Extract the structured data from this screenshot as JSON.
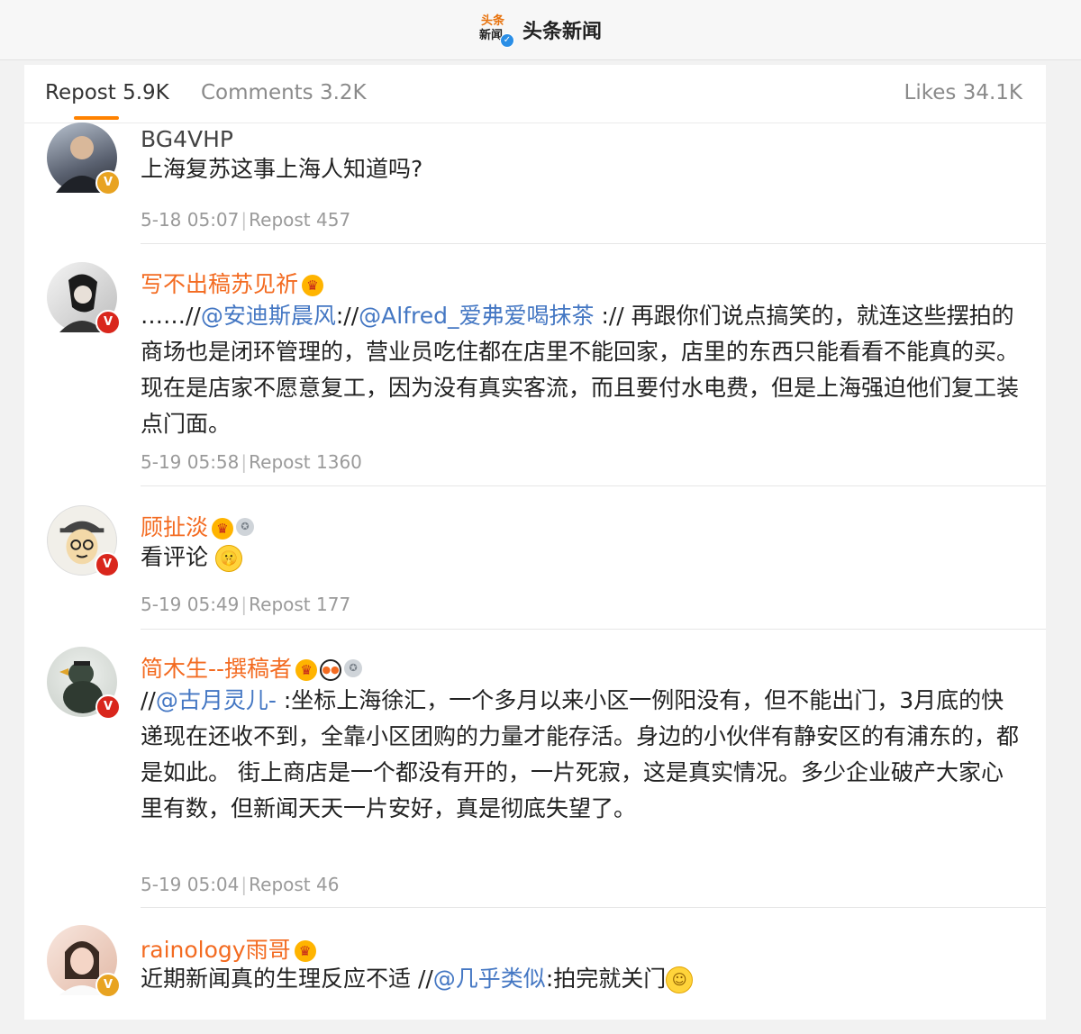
{
  "header": {
    "logo_line1": "头条",
    "logo_line2": "新闻",
    "title": "头条新闻"
  },
  "tabs": {
    "repost": "Repost 5.9K",
    "comments": "Comments 3.2K",
    "likes": "Likes 34.1K"
  },
  "colors": {
    "accent": "#ff8200",
    "username": "#f36b21",
    "mention": "#4477c3",
    "verified": "#e8a321",
    "verified_red": "#d9261c"
  },
  "posts": [
    {
      "username": "BG4VHP",
      "text": "上海复苏这事上海人知道吗?",
      "time": "5-18 05:07",
      "repost": "Repost 457"
    },
    {
      "username": "写不出稿苏见祈",
      "text_prefix": "……//",
      "mention1": "@安迪斯晨风",
      "text_mid": "://",
      "mention2": "@Alfred_爱弗爱喝抹茶",
      "text_body": " :// 再跟你们说点搞笑的，就连这些摆拍的商场也是闭环管理的，营业员吃住都在店里不能回家，店里的东西只能看看不能真的买。现在是店家不愿意复工，因为没有真实客流，而且要付水电费，但是上海强迫他们复工装点门面。",
      "time": "5-19 05:58",
      "repost": "Repost 1360"
    },
    {
      "username": "顾扯淡",
      "text": "看评论",
      "time": "5-19 05:49",
      "repost": "Repost 177"
    },
    {
      "username": "简木生--撰稿者",
      "text_prefix": "//",
      "mention": "@古月灵儿-",
      "text_body": " :坐标上海徐汇，一个多月以来小区一例阳没有，但不能出门，3月底的快递现在还收不到，全靠小区团购的力量才能存活。身边的小伙伴有静安区的有浦东的，都是如此。 街上商店是一个都没有开的，一片死寂，这是真实情况。多少企业破产大家心里有数，但新闻天天一片安好，真是彻底失望了。",
      "time": "5-19 05:04",
      "repost": "Repost 46"
    },
    {
      "username": "rainology雨哥",
      "text_prefix": "近期新闻真的生理反应不适 //",
      "mention": "@几乎类似",
      "text_body": ":拍完就关门"
    }
  ]
}
